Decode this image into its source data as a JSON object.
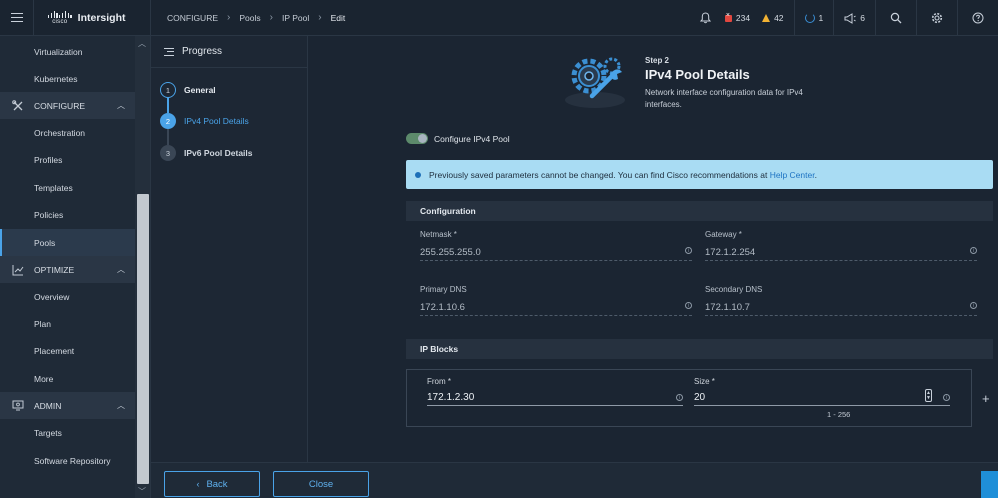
{
  "app": {
    "brand": "Intersight",
    "cisco": "cisco"
  },
  "breadcrumb": [
    {
      "label": "CONFIGURE"
    },
    {
      "label": "Pools"
    },
    {
      "label": "IP Pool"
    },
    {
      "label": "Edit"
    }
  ],
  "topbar": {
    "alarms_critical": "234",
    "alarms_warning": "42",
    "requests": "1",
    "announcements": "6"
  },
  "sidebar": {
    "items": [
      {
        "label": "Virtualization"
      },
      {
        "label": "Kubernetes"
      },
      {
        "label": "CONFIGURE"
      },
      {
        "label": "Orchestration"
      },
      {
        "label": "Profiles"
      },
      {
        "label": "Templates"
      },
      {
        "label": "Policies"
      },
      {
        "label": "Pools"
      },
      {
        "label": "OPTIMIZE"
      },
      {
        "label": "Overview"
      },
      {
        "label": "Plan"
      },
      {
        "label": "Placement"
      },
      {
        "label": "More"
      },
      {
        "label": "ADMIN"
      },
      {
        "label": "Targets"
      },
      {
        "label": "Software Repository"
      }
    ]
  },
  "progress": {
    "title": "Progress",
    "steps": [
      {
        "number": "1",
        "label": "General"
      },
      {
        "number": "2",
        "label": "IPv4 Pool Details"
      },
      {
        "number": "3",
        "label": "IPv6 Pool Details"
      }
    ]
  },
  "main": {
    "step_label": "Step 2",
    "title": "IPv4 Pool Details",
    "description": "Network interface configuration data for IPv4 interfaces.",
    "toggle_label": "Configure IPv4 Pool",
    "banner_text": "Previously saved parameters cannot be changed. You can find Cisco recommendations at ",
    "banner_link": "Help Center",
    "banner_end": ".",
    "configuration": {
      "title": "Configuration",
      "netmask_label": "Netmask *",
      "netmask_value": "255.255.255.0",
      "gateway_label": "Gateway *",
      "gateway_value": "172.1.2.254",
      "primary_dns_label": "Primary DNS",
      "primary_dns_value": "172.1.10.6",
      "secondary_dns_label": "Secondary DNS",
      "secondary_dns_value": "172.1.10.7"
    },
    "ip_blocks": {
      "title": "IP Blocks",
      "from_label": "From *",
      "from_value": "172.1.2.30",
      "size_label": "Size *",
      "size_value": "20",
      "size_range": "1 - 256"
    }
  },
  "footer": {
    "back_label": "Back",
    "close_label": "Close"
  },
  "colors": {
    "accent": "#4aa3e8",
    "banner": "#a9dcf3",
    "background": "#1b2532"
  }
}
